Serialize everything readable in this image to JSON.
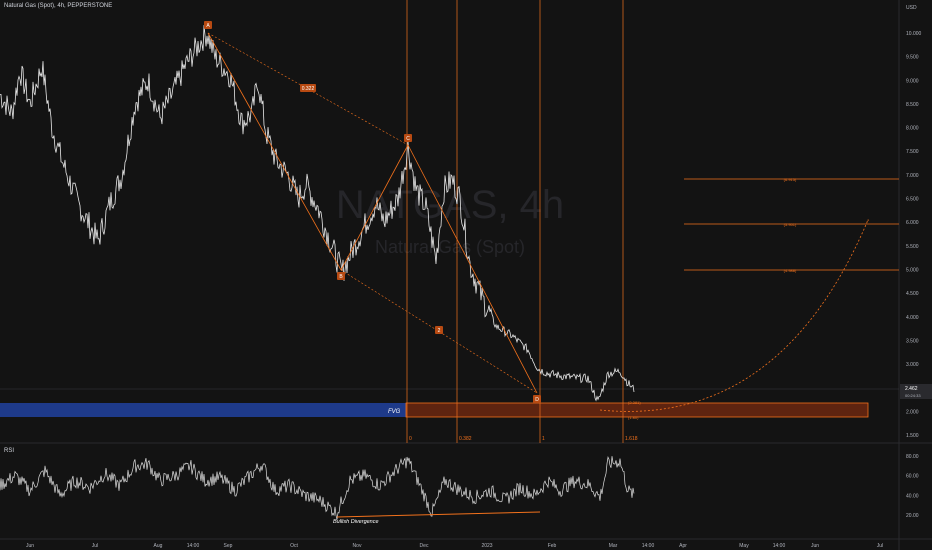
{
  "header": {
    "title": "Natural Gas (Spot), 4h, PEPPERSTONE"
  },
  "watermark": {
    "symbol": "NATGAS, 4h",
    "name": "Natural Gas (Spot)"
  },
  "price_axis": {
    "currency": "USD",
    "ticks": [
      "10.000",
      "9.500",
      "9.000",
      "8.500",
      "8.000",
      "7.500",
      "7.000",
      "6.500",
      "6.000",
      "5.500",
      "5.000",
      "4.500",
      "4.000",
      "3.500",
      "3.000",
      "2.500",
      "2.000",
      "1.500"
    ],
    "last_price": "2.462",
    "countdown": "00:24:33"
  },
  "rsi_axis": {
    "label": "RSI",
    "ticks": [
      "80.00",
      "60.00",
      "40.00",
      "20.00"
    ]
  },
  "time_axis": [
    "Jun",
    "Jul",
    "Aug",
    "14:00",
    "Sep",
    "Oct",
    "Nov",
    "Dec",
    "2023",
    "Feb",
    "Mar",
    "14:00",
    "Apr",
    "May",
    "14:00",
    "Jun",
    "Jul"
  ],
  "pattern": {
    "points": [
      {
        "label": "A",
        "date": "Aug 23",
        "price": 10.0
      },
      {
        "label": "B",
        "date": "Oct 24",
        "price": 4.92
      },
      {
        "label": "C",
        "date": "Nov 28",
        "price": 7.6
      },
      {
        "label": "D",
        "date": "Feb 22",
        "price": 2.65
      }
    ],
    "ab_ratio": "0.322",
    "bd_label": "2"
  },
  "fib_time": [
    "0",
    "0.382",
    "1",
    "1.618"
  ],
  "targets": [
    "(6.915)",
    "(5.951)",
    "(4.988)"
  ],
  "small_labels": [
    "(2.381)",
    "(1.80)"
  ],
  "fvg_label": "FVG",
  "divergence_label": "Bullish Divergence",
  "colors": {
    "background": "#131313",
    "candles": "#e8e8e8",
    "orange": "#f2711c",
    "fvg_blue": "#1e3a8a",
    "fvg_orange": "#7a2e10",
    "label_bg": "#b84a12"
  },
  "chart_data": {
    "type": "line",
    "title": "Natural Gas (Spot), 4h, PEPPERSTONE",
    "price_range": [
      1.3,
      10.55
    ],
    "rsi_range": [
      3,
      90
    ],
    "price_path": [
      [
        0,
        8.7
      ],
      [
        12,
        8.3
      ],
      [
        20,
        9.2
      ],
      [
        30,
        8.5
      ],
      [
        42,
        9.3
      ],
      [
        52,
        8.0
      ],
      [
        62,
        7.3
      ],
      [
        78,
        6.4
      ],
      [
        98,
        5.6
      ],
      [
        110,
        6.4
      ],
      [
        122,
        7.0
      ],
      [
        135,
        8.5
      ],
      [
        148,
        9.0
      ],
      [
        160,
        8.2
      ],
      [
        172,
        8.7
      ],
      [
        185,
        9.3
      ],
      [
        200,
        9.8
      ],
      [
        207,
        10.0
      ],
      [
        215,
        9.5
      ],
      [
        230,
        9.1
      ],
      [
        242,
        8.1
      ],
      [
        252,
        8.3
      ],
      [
        258,
        9.0
      ],
      [
        266,
        7.9
      ],
      [
        276,
        7.3
      ],
      [
        288,
        7.0
      ],
      [
        298,
        6.5
      ],
      [
        306,
        6.8
      ],
      [
        318,
        6.3
      ],
      [
        330,
        5.6
      ],
      [
        342,
        4.93
      ],
      [
        352,
        5.4
      ],
      [
        364,
        5.9
      ],
      [
        376,
        6.4
      ],
      [
        384,
        6.0
      ],
      [
        398,
        6.5
      ],
      [
        408,
        7.6
      ],
      [
        416,
        6.7
      ],
      [
        426,
        6.3
      ],
      [
        436,
        5.2
      ],
      [
        444,
        6.7
      ],
      [
        452,
        6.9
      ],
      [
        460,
        6.5
      ],
      [
        470,
        5.1
      ],
      [
        482,
        4.4
      ],
      [
        496,
        3.8
      ],
      [
        512,
        3.6
      ],
      [
        528,
        3.3
      ],
      [
        538,
        2.9
      ],
      [
        548,
        2.8
      ],
      [
        562,
        2.75
      ],
      [
        578,
        2.7
      ],
      [
        588,
        2.7
      ],
      [
        598,
        2.2
      ],
      [
        608,
        2.8
      ],
      [
        620,
        2.85
      ],
      [
        628,
        2.6
      ],
      [
        634,
        2.46
      ]
    ],
    "rsi_path": [
      [
        0,
        50
      ],
      [
        15,
        60
      ],
      [
        30,
        45
      ],
      [
        45,
        65
      ],
      [
        60,
        40
      ],
      [
        75,
        55
      ],
      [
        90,
        48
      ],
      [
        105,
        62
      ],
      [
        120,
        50
      ],
      [
        135,
        70
      ],
      [
        148,
        72
      ],
      [
        160,
        55
      ],
      [
        175,
        60
      ],
      [
        190,
        70
      ],
      [
        205,
        55
      ],
      [
        220,
        58
      ],
      [
        235,
        45
      ],
      [
        250,
        60
      ],
      [
        262,
        72
      ],
      [
        275,
        45
      ],
      [
        290,
        50
      ],
      [
        305,
        40
      ],
      [
        320,
        35
      ],
      [
        337,
        22
      ],
      [
        350,
        55
      ],
      [
        365,
        60
      ],
      [
        380,
        50
      ],
      [
        395,
        65
      ],
      [
        408,
        76
      ],
      [
        420,
        50
      ],
      [
        432,
        22
      ],
      [
        445,
        55
      ],
      [
        460,
        45
      ],
      [
        475,
        38
      ],
      [
        490,
        45
      ],
      [
        505,
        35
      ],
      [
        520,
        48
      ],
      [
        535,
        40
      ],
      [
        548,
        55
      ],
      [
        560,
        45
      ],
      [
        575,
        55
      ],
      [
        590,
        50
      ],
      [
        600,
        38
      ],
      [
        608,
        72
      ],
      [
        620,
        75
      ],
      [
        628,
        45
      ],
      [
        634,
        40
      ]
    ],
    "divergence": {
      "rsi_start": [
        337,
        22
      ],
      "rsi_end": [
        540,
        25
      ],
      "price_low": 4.93
    }
  }
}
